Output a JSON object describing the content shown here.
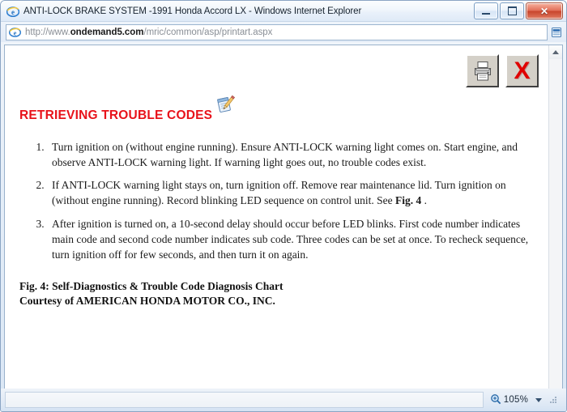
{
  "window": {
    "title": "ANTI-LOCK BRAKE SYSTEM -1991 Honda Accord LX - Windows Internet Explorer",
    "minimize_label": "Minimize",
    "maximize_label": "Maximize",
    "close_label": "✕"
  },
  "address": {
    "scheme_path_prefix": "http://www.",
    "domain": "ondemand5.com",
    "path": "/mric/common/asp/printart.aspx",
    "full_url": "http://www.ondemand5.com/mric/common/asp/printart.aspx",
    "favicon": "ie-logo-icon",
    "right_icon": "rss-feed-icon"
  },
  "page_tools": {
    "print": {
      "name": "print-icon",
      "label": "Print"
    },
    "close": {
      "name": "close-x-icon",
      "label": "X"
    }
  },
  "document": {
    "heading": "RETRIEVING TROUBLE CODES",
    "heading_icon": "notepad-pencil-icon",
    "heading_color": "#e8121a",
    "steps": [
      "Turn ignition on (without engine running). Ensure ANTI-LOCK warning light comes on. Start engine, and observe ANTI-LOCK warning light. If warning light goes out, no trouble codes exist.",
      "If ANTI-LOCK warning light stays on, turn ignition off. Remove rear maintenance lid. Turn ignition on (without engine running). Record blinking LED sequence on control unit. See ",
      "After ignition is turned on, a 10-second delay should occur before LED blinks. First code number indicates main code and second code number indicates sub code. Three codes can be set at once. To recheck sequence, turn ignition off for few seconds, and then turn it on again."
    ],
    "step2_figure_ref": "Fig. 4",
    "step2_tail": " .",
    "caption_line1": "Fig. 4: Self-Diagnostics & Trouble Code Diagnosis Chart",
    "caption_line2": "Courtesy of AMERICAN HONDA MOTOR CO., INC."
  },
  "statusbar": {
    "status_text": "",
    "zoom_level": "105%",
    "zoom_icon": "magnifier-plus-icon"
  }
}
